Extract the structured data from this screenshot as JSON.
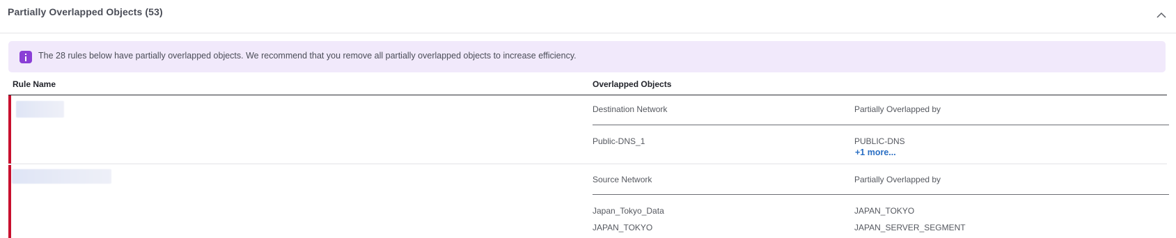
{
  "section": {
    "title": "Partially Overlapped Objects (53)",
    "collapse_icon": "chevron-up-icon"
  },
  "banner": {
    "icon": "info-icon",
    "text": "The 28 rules below have partially overlapped objects. We recommend that you remove all partially overlapped objects to increase efficiency."
  },
  "table": {
    "columns": [
      "Rule Name",
      "Overlapped Objects"
    ],
    "rows": [
      {
        "object_type": "Destination Network",
        "overlap_header": "Partially Overlapped by",
        "objects": [
          {
            "name": "Public-DNS_1",
            "overlapped_by": "PUBLIC-DNS",
            "more": "+1 more..."
          }
        ]
      },
      {
        "object_type": "Source Network",
        "overlap_header": "Partially Overlapped by",
        "objects": [
          {
            "name": "Japan_Tokyo_Data",
            "overlapped_by": "JAPAN_TOKYO"
          },
          {
            "name": "JAPAN_TOKYO",
            "overlapped_by": "JAPAN_SERVER_SEGMENT"
          }
        ]
      }
    ]
  },
  "colors": {
    "accent_bar": "#c8102e",
    "banner_bg": "#f1e9fb",
    "info_icon": "#8a3fd6",
    "link": "#2a6fc4"
  }
}
